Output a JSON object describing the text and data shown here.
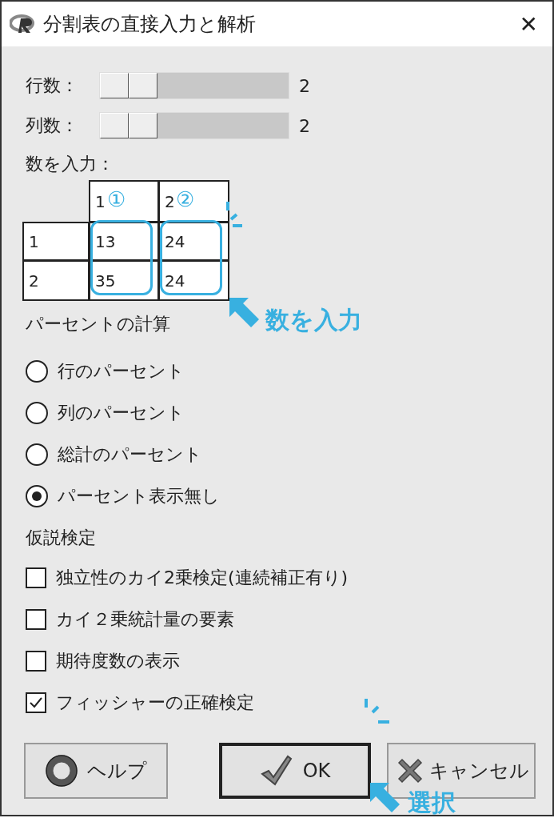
{
  "window": {
    "title": "分割表の直接入力と解析",
    "close": "✕"
  },
  "sliders": [
    {
      "label": "行数：",
      "reading": "2"
    },
    {
      "label": "列数：",
      "reading": "2"
    }
  ],
  "table": {
    "label": "数を入力：",
    "columns": [
      "1",
      "2"
    ],
    "rows": [
      {
        "header": "1",
        "cells": [
          "13",
          "24"
        ]
      },
      {
        "header": "2",
        "cells": [
          "35",
          "24"
        ]
      }
    ]
  },
  "percent": {
    "label": "パーセントの計算",
    "options": [
      {
        "label": "行のパーセント",
        "selected": false
      },
      {
        "label": "列のパーセント",
        "selected": false
      },
      {
        "label": "総計のパーセント",
        "selected": false
      },
      {
        "label": "パーセント表示無し",
        "selected": true
      }
    ]
  },
  "tests": {
    "label": "仮説検定",
    "options": [
      {
        "label": "独立性のカイ2乗検定(連続補正有り)",
        "checked": false
      },
      {
        "label": "カイ２乗統計量の要素",
        "checked": false
      },
      {
        "label": "期待度数の表示",
        "checked": false
      },
      {
        "label": "フィッシャーの正確検定",
        "checked": true
      }
    ]
  },
  "buttons": [
    {
      "kind": "help",
      "label": "ヘルプ"
    },
    {
      "kind": "ok",
      "label": "OK"
    },
    {
      "kind": "cancel",
      "label": "キャンセル"
    }
  ],
  "annotations": {
    "column_marks": [
      "①",
      "②"
    ],
    "table_note": "数を入力",
    "button_note": "選択"
  }
}
